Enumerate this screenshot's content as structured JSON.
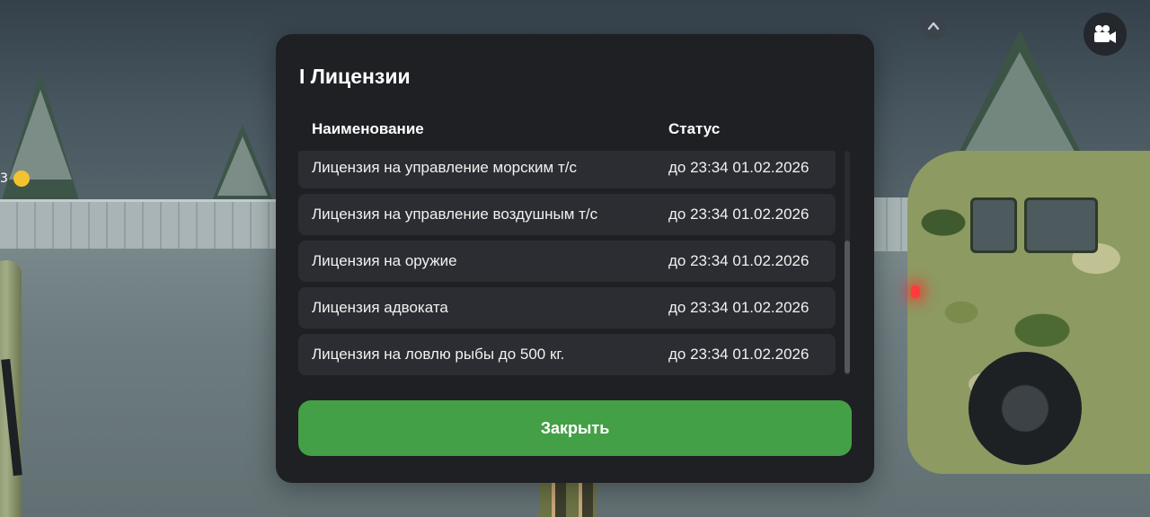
{
  "hud": {
    "left_counter": "3",
    "chevron_icon": "chevron-up-icon",
    "camera_icon": "video-camera-icon"
  },
  "modal": {
    "title": "I Лицензии",
    "columns": {
      "name": "Наименование",
      "status": "Статус"
    },
    "rows": [
      {
        "name": "Лицензия на управление морским т/с",
        "status": "до 23:34 01.02.2026"
      },
      {
        "name": "Лицензия на управление воздушным т/с",
        "status": "до 23:34 01.02.2026"
      },
      {
        "name": "Лицензия на оружие",
        "status": "до 23:34 01.02.2026"
      },
      {
        "name": "Лицензия адвоката",
        "status": "до 23:34 01.02.2026"
      },
      {
        "name": "Лицензия на ловлю рыбы до 500 кг.",
        "status": "до 23:34 01.02.2026"
      }
    ],
    "close_label": "Закрыть"
  },
  "colors": {
    "modal_bg": "#1f2024",
    "row_bg": "#2c2d32",
    "close_button": "#44a046",
    "text": "#ffffff"
  }
}
